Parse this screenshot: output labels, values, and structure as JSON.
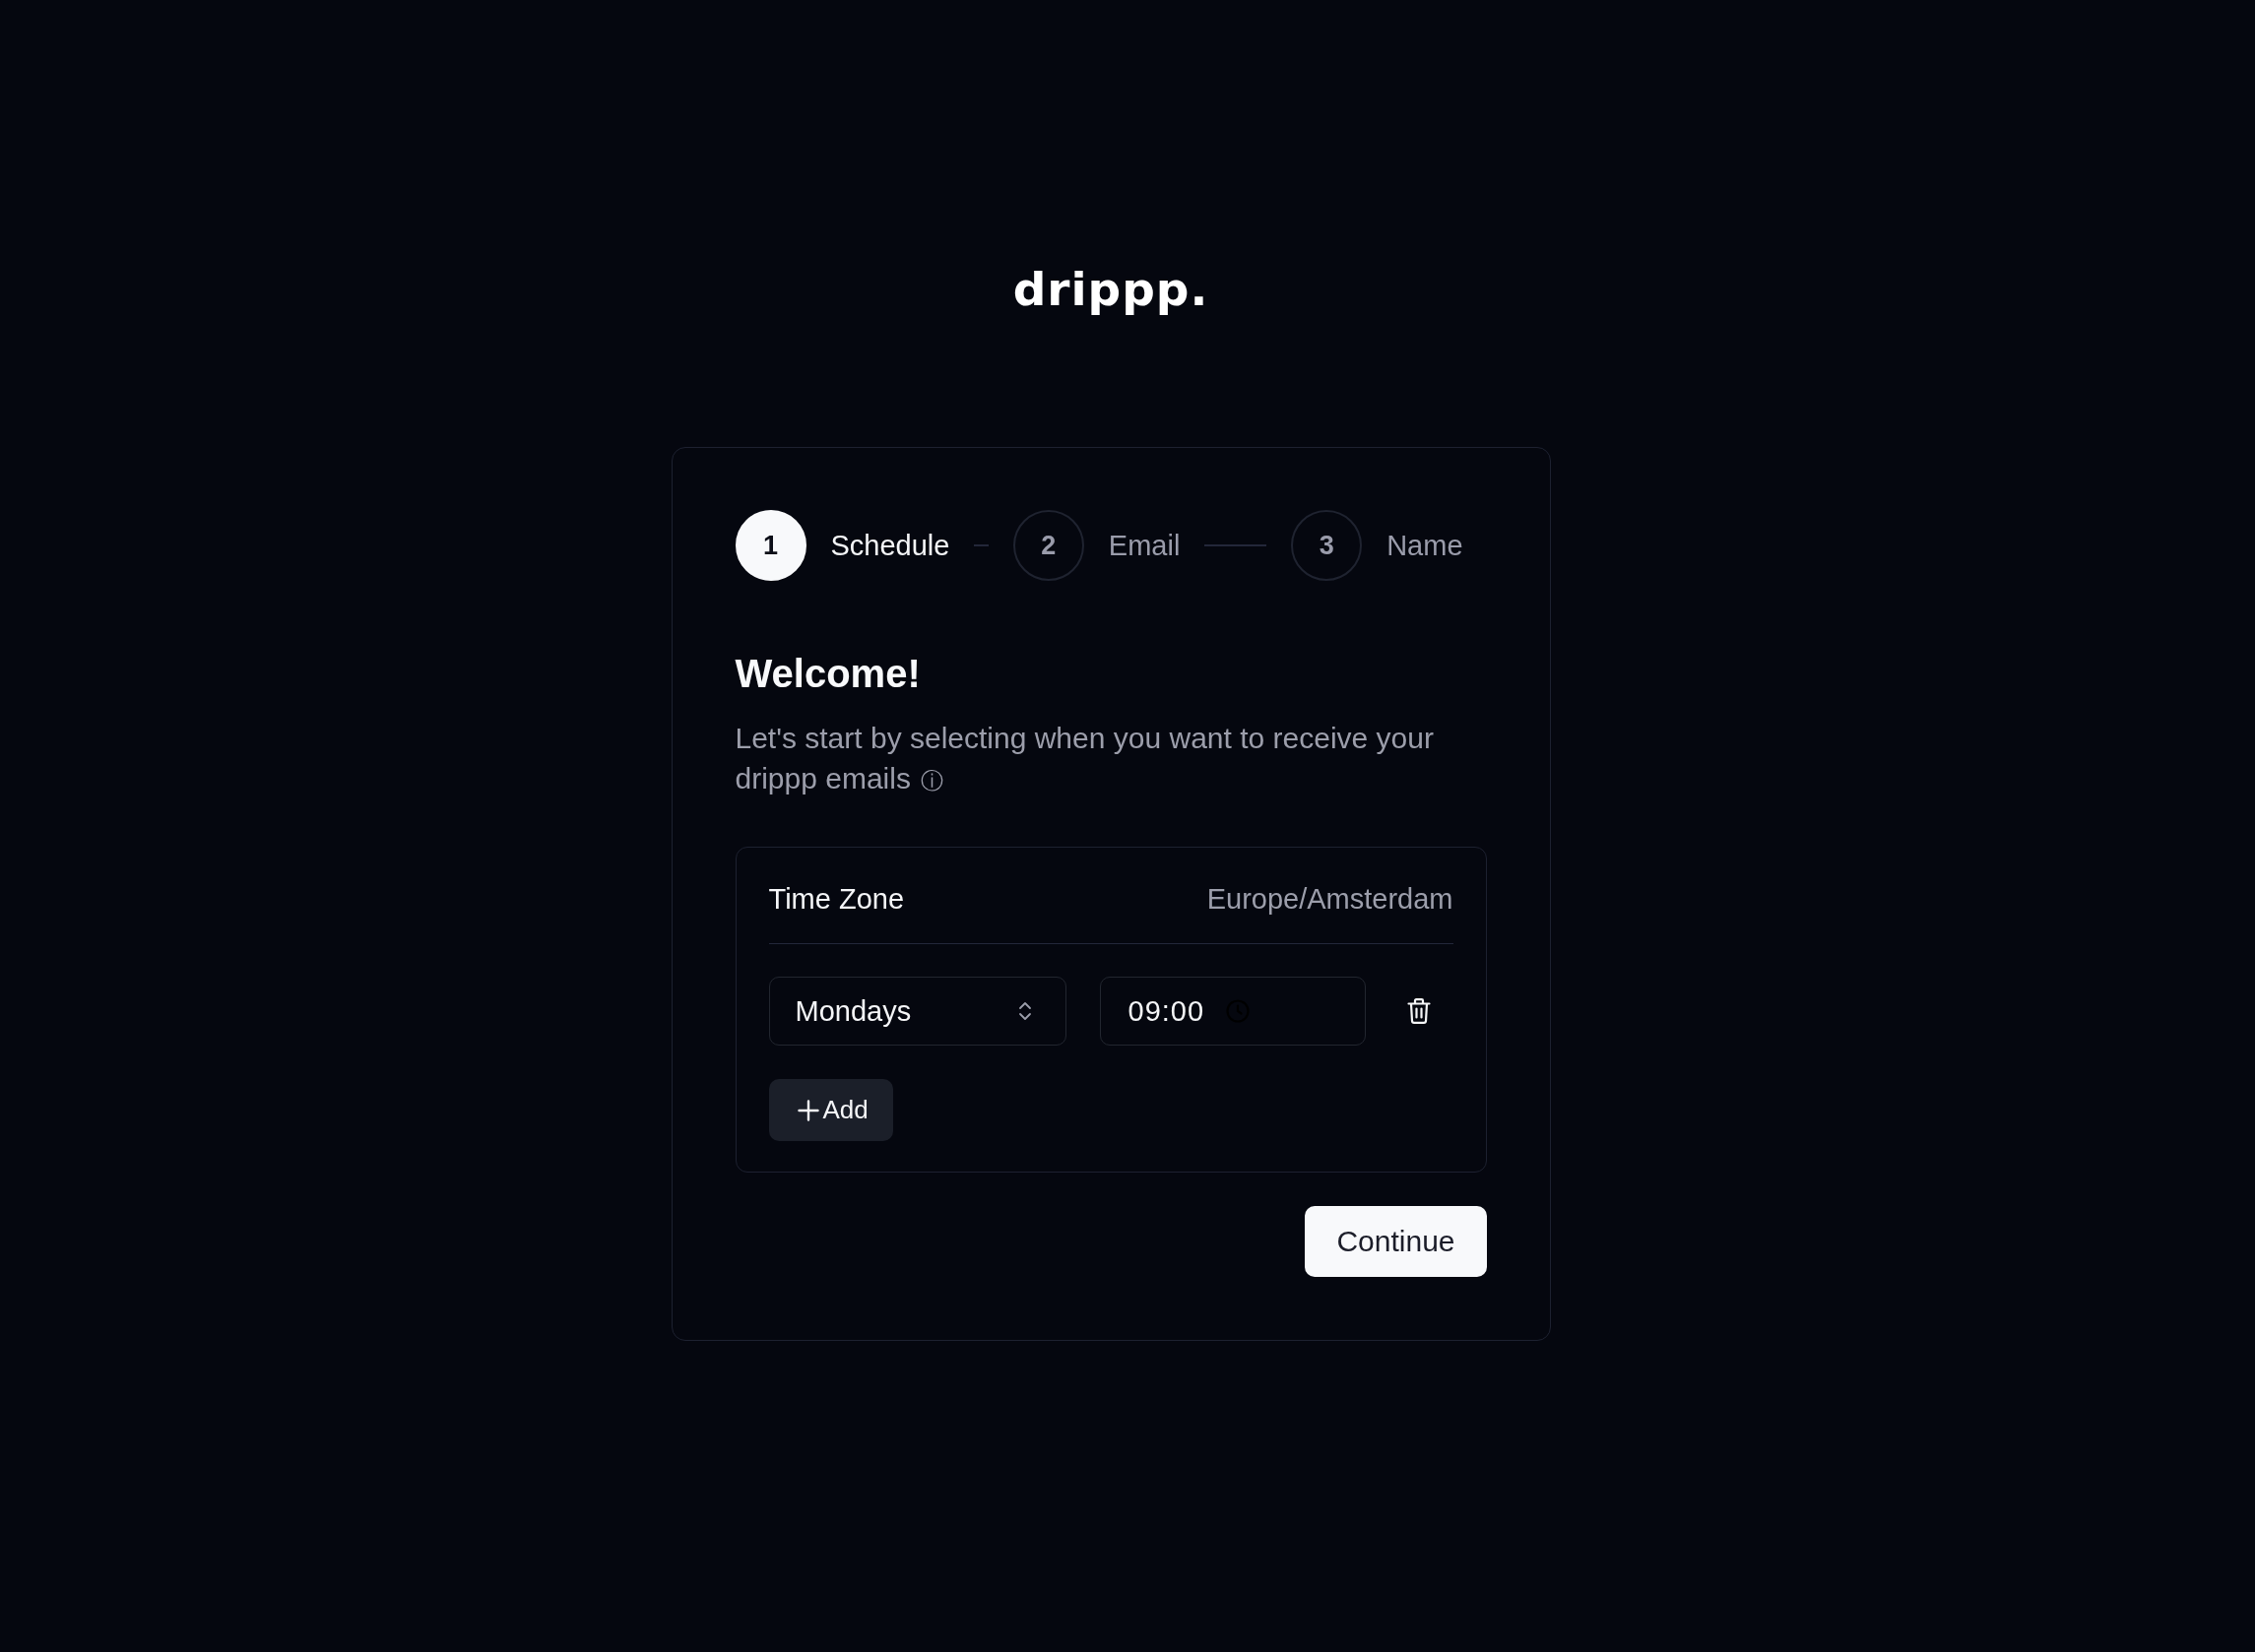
{
  "logo": {
    "text": "drippp."
  },
  "stepper": {
    "steps": [
      {
        "number": "1",
        "label": "Schedule",
        "selected": true
      },
      {
        "number": "2",
        "label": "Email",
        "selected": false
      },
      {
        "number": "3",
        "label": "Name",
        "selected": false
      }
    ]
  },
  "heading": "Welcome!",
  "intro": "Let's start by selecting when you want to receive your drippp emails",
  "info_symbol": "ⓘ",
  "schedule": {
    "timezone_label": "Time Zone",
    "timezone_value": "Europe/Amsterdam",
    "entries": [
      {
        "day": "Mondays",
        "time": "09:00"
      }
    ],
    "add_button": "Add"
  },
  "continue_button": "Continue"
}
